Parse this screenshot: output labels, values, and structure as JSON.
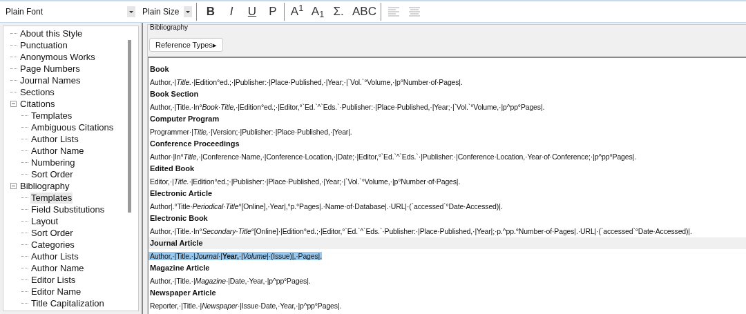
{
  "toolbar": {
    "font": "Plain Font",
    "size": "Plain Size",
    "buttons": [
      {
        "kind": "bold",
        "label": "B"
      },
      {
        "kind": "italic",
        "label": "I"
      },
      {
        "kind": "underline",
        "label": "U"
      },
      {
        "kind": "plain",
        "label": "P"
      },
      {
        "kind": "plain",
        "label": "A$^{1}$"
      },
      {
        "kind": "plain",
        "label": "A$_{1}$"
      },
      {
        "kind": "plain",
        "label": "Σ."
      },
      {
        "kind": "plain",
        "label": "ABC"
      },
      {
        "kind": "align-left"
      },
      {
        "kind": "align-justify"
      }
    ]
  },
  "tree": [
    {
      "label": "About this Style",
      "selected": false
    },
    {
      "label": "Punctuation",
      "selected": false
    },
    {
      "label": "Anonymous Works",
      "selected": false
    },
    {
      "label": "Page Numbers",
      "selected": false
    },
    {
      "label": "Journal Names",
      "selected": false
    },
    {
      "label": "Sections",
      "selected": false
    },
    {
      "label": "Citations",
      "selected": false,
      "expanded": true,
      "children": [
        {
          "label": "Templates",
          "selected": false
        },
        {
          "label": "Ambiguous Citations",
          "selected": false
        },
        {
          "label": "Author Lists",
          "selected": false
        },
        {
          "label": "Author Name",
          "selected": false
        },
        {
          "label": "Numbering",
          "selected": false
        },
        {
          "label": "Sort Order",
          "selected": false
        }
      ]
    },
    {
      "label": "Bibliography",
      "selected": false,
      "expanded": true,
      "children": [
        {
          "label": "Templates",
          "selected": true
        },
        {
          "label": "Field Substitutions",
          "selected": false
        },
        {
          "label": "Layout",
          "selected": false
        },
        {
          "label": "Sort Order",
          "selected": false
        },
        {
          "label": "Categories",
          "selected": false
        },
        {
          "label": "Author Lists",
          "selected": false
        },
        {
          "label": "Author Name",
          "selected": false
        },
        {
          "label": "Editor Lists",
          "selected": false
        },
        {
          "label": "Editor Name",
          "selected": false
        },
        {
          "label": "Title Capitalization",
          "selected": false
        }
      ]
    }
  ],
  "group": {
    "title": "Bibliography",
    "reference_button": "Reference Types▸"
  },
  "templates": [
    {
      "type": "Book",
      "template": "Author,·|*Title.*·|Edition°ed.;·|Publisher:·|Place·Published,·|Year;·|`Vol.`°Volume,·|p°Number·of·Pages|.",
      "selected": false
    },
    {
      "type": "Book Section",
      "template": "Author,·|Title.·In°*Book·Title,*·|Edition°ed.;·|Editor,°`Ed.`^`Eds.`·Publisher:·|Place·Published,·|Year;·|`Vol.`°Volume,·|p^pp°Pages|.",
      "selected": false
    },
    {
      "type": "Computer Program",
      "template": "Programmer·|*Title,*·|Version;·|Publisher:·|Place·Published,·|Year|.",
      "selected": false
    },
    {
      "type": "Conference Proceedings",
      "template": "Author·|In°*Title,*·|Conference·Name,·|Conference·Location,·|Date;·|Editor,°`Ed.`^`Eds.`·|Publisher:·|Conference·Location,·Year·of·Conference;·|p^pp°Pages|.",
      "selected": false
    },
    {
      "type": "Edited Book",
      "template": "Editor,·|*Title.*·|Edition°ed.;·|Publisher:·|Place·Published,·|Year;·|`Vol.`°Volume,·|p°Number·of·Pages|.",
      "selected": false
    },
    {
      "type": "Electronic Article",
      "template": "Author|.°Title·*Periodical·Title*°[Online],·Year|,°p.°Pages|.·Name·of·Database|.·URL|·(`accessed`°Date·Accessed)|.",
      "selected": false
    },
    {
      "type": "Electronic Book",
      "template": "Author,·|Title.·In°*Secondary·Title*°[Online]·|Edition°ed.;·|Editor,°`Ed.`^`Eds.`·Publisher:·|Place·Published,·|Year|;·p.^pp.°Number·of·Pages|.·URL|·(`accessed`°Date·Accessed)|.",
      "selected": false
    },
    {
      "type": "Journal Article",
      "template": "Author,·|Title.·|*Journal*·|**Year,**·|*Volume*|·(Issue)|,·Pages|.",
      "selected": true
    },
    {
      "type": "Magazine Article",
      "template": "Author,·|Title.·|*Magazine*·|Date,·Year,·|p^pp°Pages|.",
      "selected": false
    },
    {
      "type": "Newspaper Article",
      "template": "Reporter,·|Title.·|*Newspaper*·|Issue·Date,·Year,·|p^pp°Pages|.",
      "selected": false
    }
  ]
}
